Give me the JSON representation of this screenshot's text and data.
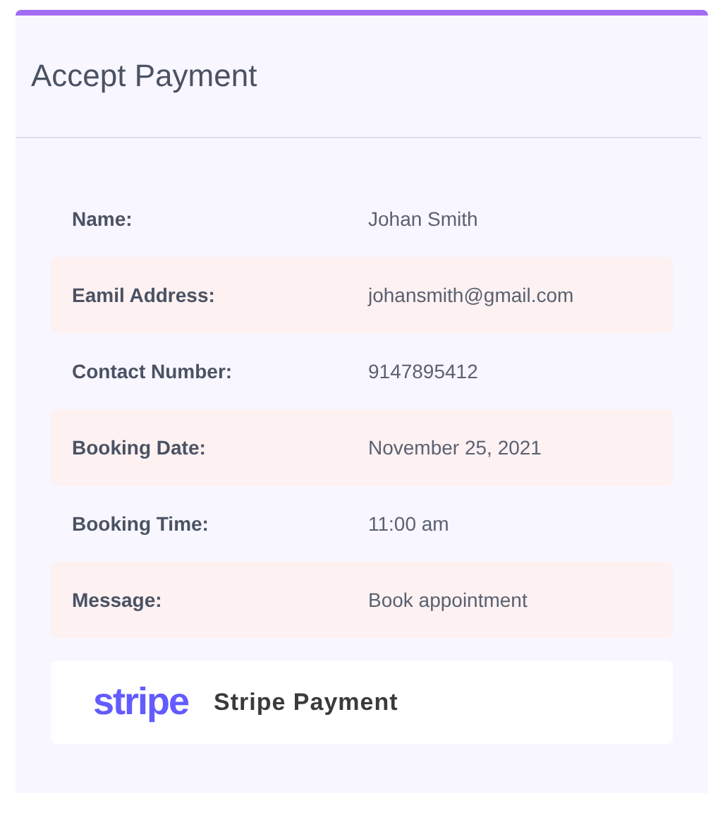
{
  "title": "Accept Payment",
  "details": [
    {
      "label": "Name:",
      "value": "Johan Smith"
    },
    {
      "label": "Eamil Address:",
      "value": "johansmith@gmail.com"
    },
    {
      "label": "Contact Number:",
      "value": "9147895412"
    },
    {
      "label": "Booking Date:",
      "value": "November 25, 2021"
    },
    {
      "label": "Booking Time:",
      "value": "11:00 am"
    },
    {
      "label": "Message:",
      "value": "Book appointment"
    }
  ],
  "payment_option": {
    "logo": "stripe",
    "label": "Stripe Payment"
  }
}
